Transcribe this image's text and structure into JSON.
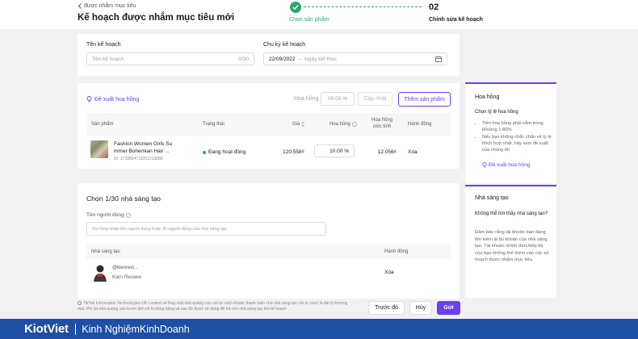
{
  "header": {
    "back_label": "được nhắm mục tiêu",
    "title": "Kế hoạch được nhắm mục tiêu mới",
    "step1_label": "Chọn sản phẩm",
    "step2_number": "02",
    "step2_label": "Chỉnh sửa kế hoạch"
  },
  "plan": {
    "name_label": "Tên kế hoạch",
    "name_placeholder": "Tên kế hoạch",
    "name_counter": "0/30",
    "cycle_label": "Chu kỳ kế hoạch",
    "start_date": "22/09/2022",
    "date_sep": "–",
    "end_placeholder": "Ngày kết thúc"
  },
  "commission": {
    "suggest_label": "Đề xuất hoa hồng",
    "rate_label": "Hoa hồng",
    "rate_value": "00.00 %",
    "update_button": "Cập nhật",
    "add_product_button": "Thêm sản phẩm",
    "columns": {
      "product": "Sản phẩm",
      "status": "Trạng thái",
      "price": "Giá",
      "commission": "Hoa hồng",
      "commission_est": "Hoa hồng ước tính",
      "action": "Hành động"
    },
    "row": {
      "name_line1": "Fashion Women Girls Su",
      "name_line2": "mmer Bohemian Hair ...",
      "id": "ID: 1729504719251213086",
      "status": "Đang hoạt động",
      "price": "120.558₫",
      "commission": "10.00 %",
      "commission_est": "12.056₫",
      "action": "Xóa"
    }
  },
  "creators": {
    "heading_prefix": "Chọn",
    "heading_count": "1/30",
    "heading_suffix": "nhà sáng tạo",
    "username_label": "Tên người dùng",
    "username_placeholder": "Vui lòng nhập tên người dùng hoặc ID người dùng của nhà sáng tạo",
    "col_creator": "Nhà sáng tạo",
    "col_action": "Hành động",
    "row": {
      "handle": "@kienrevi...",
      "name": "Kien Review",
      "action": "Xóa"
    }
  },
  "sidebar": {
    "commission_card": {
      "title": "Hoa hồng",
      "subtitle": "Chọn tỷ lệ hoa hồng",
      "bullet1": "Tiền hoa hồng phải nằm trong khoảng 1-80%",
      "bullet2": "Nếu bạn không chắc chắn về tỷ lệ thích hợp nhất, hãy xem đề xuất của chúng tôi",
      "link": "Đề xuất hoa hồng"
    },
    "creator_card": {
      "title": "Nhà sáng tạo",
      "subtitle": "Không thể tìm thấy nhà sáng tạo?",
      "body": "Đảm bảo rằng tài khoản bạn đang tìm kiếm là tài khoản của nhà sáng tạo. Tài khoản chính thức/tiếp thị của bạn không thể thêm vào các kế hoạch được nhắm mục tiêu."
    }
  },
  "footer": {
    "note": "TikTok Information Technologies UK Limited sẽ thay mặt nhà quảng cáo với tư cách khoản thanh toán cho nhà sáng tạo với tư cách là đại lý thương mại. Phí do nhà quảng cáo trước tiên sẽ bị đóng băng và sau đó được sẽ dùng để trả cho nhà sáng tạo khi kế hoạch",
    "prev_button": "Trước đó",
    "cancel_button": "Hủy",
    "send_button": "Gửi"
  },
  "brand": {
    "logo": "KiotViet",
    "tagline": "Kinh NghiệmKinhDoanh"
  },
  "colors": {
    "accent": "#6b3ef0",
    "success": "#29a96f",
    "brand_bar": "#1e4fa5"
  }
}
